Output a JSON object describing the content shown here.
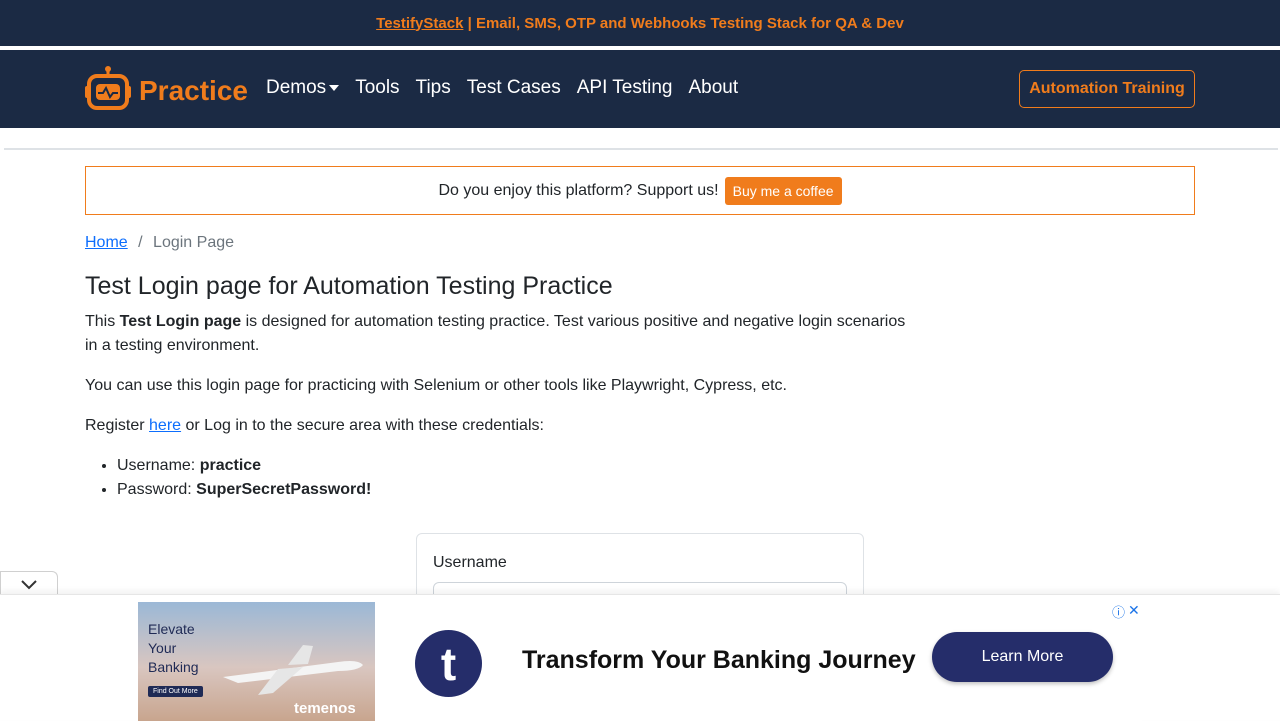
{
  "promo": {
    "link": "TestifyStack",
    "text": " | Email, SMS, OTP and Webhooks Testing Stack for QA & Dev"
  },
  "navbar": {
    "brand": "Practice",
    "items": [
      "Demos",
      "Tools",
      "Tips",
      "Test Cases",
      "API Testing",
      "About"
    ],
    "training_button": "Automation Training"
  },
  "support": {
    "text": "Do you enjoy this platform? Support us!",
    "button": "Buy me a coffee"
  },
  "breadcrumb": {
    "home": "Home",
    "separator": "/",
    "current": "Login Page"
  },
  "main": {
    "title": "Test Login page for Automation Testing Practice",
    "p1_pre": "This ",
    "p1_bold": "Test Login page",
    "p1_post": " is designed for automation testing practice. Test various positive and negative login scenarios in a testing environment.",
    "p2": "You can use this login page for practicing with Selenium or other tools like Playwright, Cypress, etc.",
    "p3_pre": "Register ",
    "p3_link": "here",
    "p3_post": " or Log in to the secure area with these credentials:",
    "credentials": [
      {
        "label": "Username: ",
        "value": "practice"
      },
      {
        "label": "Password: ",
        "value": "SuperSecretPassword!"
      }
    ]
  },
  "login_form": {
    "username_label": "Username"
  },
  "ad": {
    "image_text": "Elevate Your Banking",
    "image_cta": "Find Out More",
    "image_brand": "temenos",
    "logo_letter": "t",
    "headline": "Transform Your Banking Journey",
    "cta": "Learn More"
  },
  "colors": {
    "accent": "#f07c1c",
    "navbar_bg": "#1b2a44",
    "link": "#0d6efd",
    "ad_brand": "#252d6a"
  }
}
